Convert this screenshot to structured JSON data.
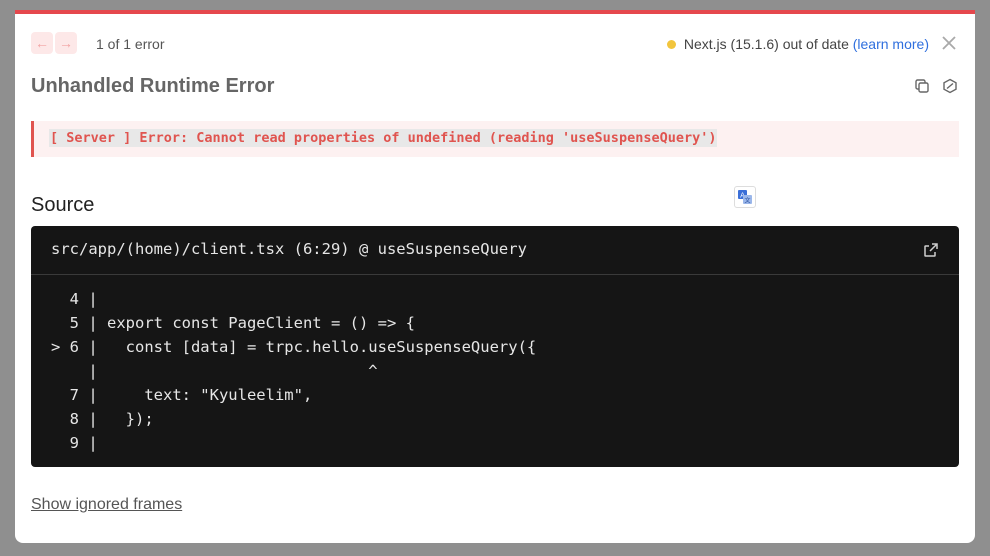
{
  "nav": {
    "prev_glyph": "←",
    "next_glyph": "→",
    "error_count": "1 of 1 error"
  },
  "version": {
    "text": "Next.js (15.1.6) out of date",
    "link": "(learn more)",
    "status_color": "#f2c53d"
  },
  "header": {
    "title": "Unhandled Runtime Error"
  },
  "error": {
    "message": "[ Server ] Error: Cannot read properties of undefined (reading 'useSuspenseQuery')"
  },
  "source": {
    "title": "Source",
    "file": "src/app/(home)/client.tsx (6:29) @ useSuspenseQuery",
    "lines": [
      "  4 |",
      "  5 | export const PageClient = () => {",
      "> 6 |   const [data] = trpc.hello.useSuspenseQuery({",
      "    |                             ^",
      "  7 |     text: \"Kyuleelim\",",
      "  8 |   });",
      "  9 |"
    ]
  },
  "footer": {
    "show_ignored": "Show ignored frames"
  },
  "colors": {
    "accent_red": "#e5484d",
    "link_blue": "#2f6fde",
    "code_bg": "#151515"
  }
}
